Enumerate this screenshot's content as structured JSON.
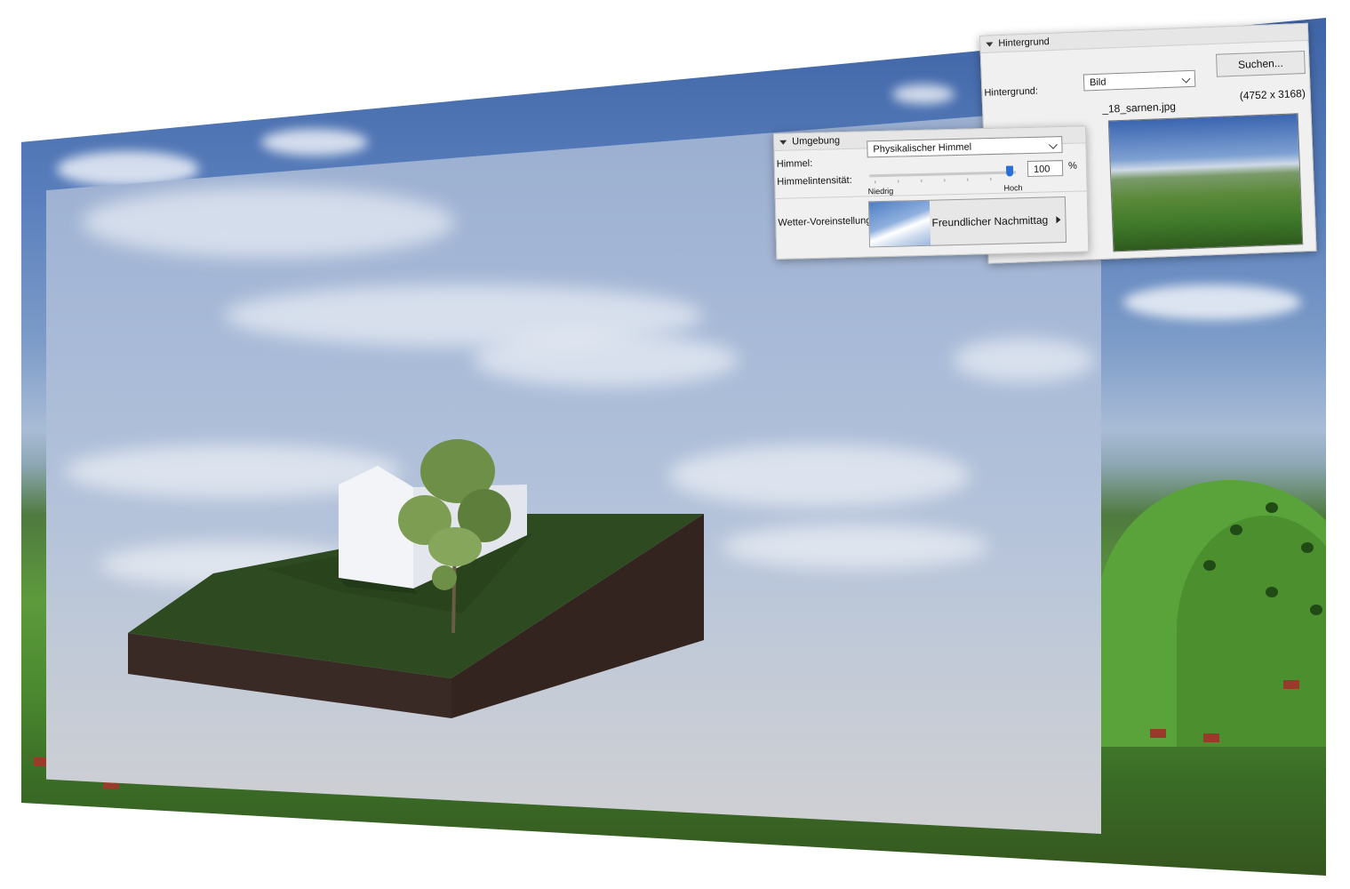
{
  "background_panel": {
    "section_title": "Hintergrund",
    "label": "Hintergrund:",
    "type_value": "Bild",
    "search_button": "Suchen...",
    "file_name": "_18_sarnen.jpg",
    "dimensions": "(4752 x 3168)"
  },
  "environment_panel": {
    "section_title": "Umgebung",
    "sky_label": "Himmel:",
    "sky_value": "Physikalischer Himmel",
    "intensity_label": "Himmelintensität:",
    "intensity_value": "100",
    "intensity_unit": "%",
    "slider_min_label": "Niedrig",
    "slider_max_label": "Hoch",
    "slider_level": 0.96,
    "weather_label": "Wetter-Voreinstellung:",
    "weather_value": "Freundlicher Nachmittag"
  },
  "colors": {
    "accent": "#2a6fd6",
    "grass": "#2d4a20",
    "soil": "#3a2a26"
  }
}
